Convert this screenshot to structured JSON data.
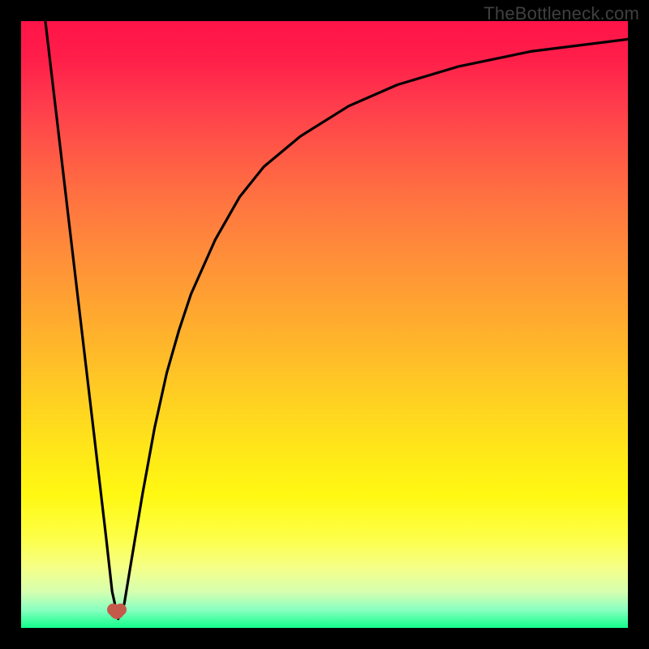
{
  "watermark": "TheBottleneck.com",
  "heart": {
    "left_pct": 15.8,
    "top_pct": 97.2
  },
  "colors": {
    "frame": "#000000",
    "curve": "#000000",
    "heart": "#c45a4a",
    "watermark": "#404040"
  },
  "chart_data": {
    "type": "line",
    "title": "",
    "xlabel": "",
    "ylabel": "",
    "xlim": [
      0,
      100
    ],
    "ylim": [
      0,
      100
    ],
    "grid": false,
    "legend": false,
    "series": [
      {
        "name": "curve",
        "x": [
          4,
          6,
          8,
          10,
          12,
          14,
          15,
          16,
          17,
          18,
          20,
          22,
          24,
          26,
          28,
          32,
          36,
          40,
          46,
          54,
          62,
          72,
          84,
          100
        ],
        "y": [
          100,
          83,
          66,
          49,
          32,
          15,
          6,
          1.5,
          4,
          10,
          22,
          33,
          42,
          49,
          55,
          64,
          71,
          76,
          81,
          86,
          89.5,
          92.5,
          95,
          97
        ]
      }
    ],
    "annotations": [
      {
        "type": "marker",
        "shape": "heart",
        "x": 15.8,
        "y": 2.8
      }
    ]
  },
  "gradient_stops": [
    {
      "pct": 0,
      "color": "#ff1448"
    },
    {
      "pct": 14,
      "color": "#ff3d4c"
    },
    {
      "pct": 30,
      "color": "#ff7540"
    },
    {
      "pct": 46,
      "color": "#ffa232"
    },
    {
      "pct": 62,
      "color": "#ffcf22"
    },
    {
      "pct": 78,
      "color": "#fff812"
    },
    {
      "pct": 90,
      "color": "#f6ff86"
    },
    {
      "pct": 97,
      "color": "#8affc0"
    },
    {
      "pct": 100,
      "color": "#14ff8c"
    }
  ]
}
